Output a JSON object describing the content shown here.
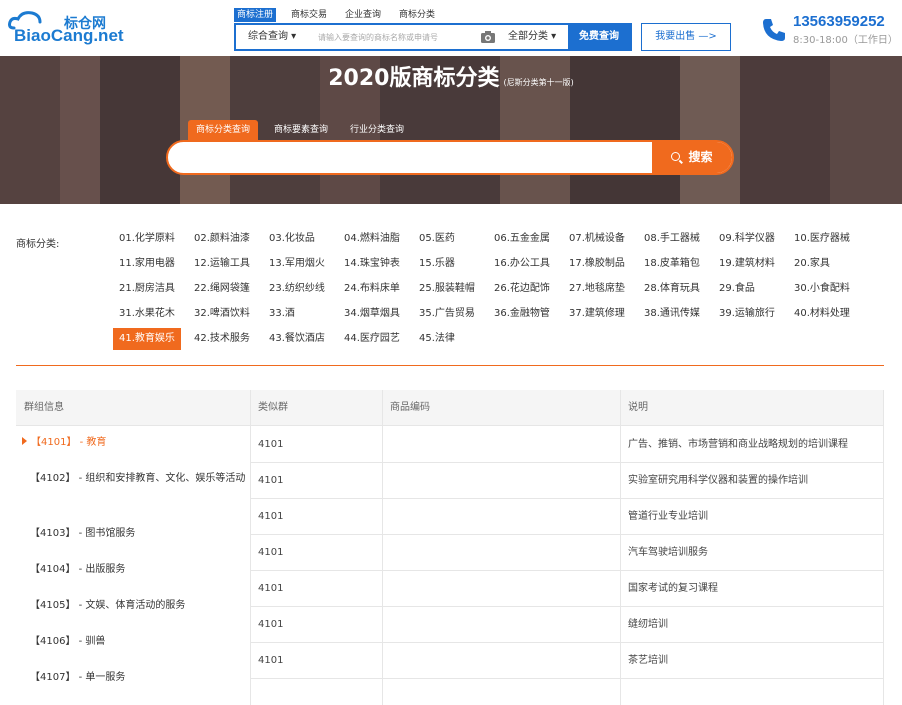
{
  "header": {
    "logo_cn": "标仓网",
    "logo_en": "BiaoCang.net",
    "nav_tabs": [
      "商标注册",
      "商标交易",
      "企业查询",
      "商标分类"
    ],
    "search_type": "综合查询 ▾",
    "search_placeholder": "请输入要查询的商标名称或申请号",
    "search_category": "全部分类 ▾",
    "search_button": "免费查询",
    "sell_button": "我要出售 —>",
    "phone": "13563959252",
    "hours": "8:30-18:00（工作日）"
  },
  "banner": {
    "title": "2020版商标分类",
    "subtitle": "(尼斯分类第十一版)",
    "tabs": [
      "商标分类查询",
      "商标要素查询",
      "行业分类查询"
    ],
    "search_button": "搜索"
  },
  "categories": {
    "label": "商标分类:",
    "items": [
      "01.化学原料",
      "02.颜料油漆",
      "03.化妆品",
      "04.燃料油脂",
      "05.医药",
      "06.五金金属",
      "07.机械设备",
      "08.手工器械",
      "09.科学仪器",
      "10.医疗器械",
      "11.家用电器",
      "12.运输工具",
      "13.军用烟火",
      "14.珠宝钟表",
      "15.乐器",
      "16.办公工具",
      "17.橡胶制品",
      "18.皮革箱包",
      "19.建筑材料",
      "20.家具",
      "21.厨房洁具",
      "22.绳网袋篷",
      "23.纺织纱线",
      "24.布料床单",
      "25.服装鞋帽",
      "26.花边配饰",
      "27.地毯席垫",
      "28.体育玩具",
      "29.食品",
      "30.小食配料",
      "31.水果花木",
      "32.啤酒饮料",
      "33.酒",
      "34.烟草烟具",
      "35.广告贸易",
      "36.金融物管",
      "37.建筑修理",
      "38.通讯传媒",
      "39.运输旅行",
      "40.材料处理",
      "41.教育娱乐",
      "42.技术服务",
      "43.餐饮酒店",
      "44.医疗园艺",
      "45.法律"
    ],
    "active": "41.教育娱乐"
  },
  "table": {
    "headers": [
      "群组信息",
      "类似群",
      "商品编码",
      "说明"
    ],
    "groups": [
      "【4101】 - 教育",
      "【4102】 - 组织和安排教育、文化、娱乐等活动",
      "【4103】 - 图书馆服务",
      "【4104】 - 出版服务",
      "【4105】 - 文娱、体育活动的服务",
      "【4106】 - 驯兽",
      "【4107】 - 单一服务"
    ],
    "rows": [
      {
        "group": "4101",
        "code": "",
        "desc": "广告、推销、市场营销和商业战略规划的培训课程"
      },
      {
        "group": "4101",
        "code": "",
        "desc": "实验室研究用科学仪器和装置的操作培训"
      },
      {
        "group": "4101",
        "code": "",
        "desc": "管道行业专业培训"
      },
      {
        "group": "4101",
        "code": "",
        "desc": "汽车驾驶培训服务"
      },
      {
        "group": "4101",
        "code": "",
        "desc": "国家考试的复习课程"
      },
      {
        "group": "4101",
        "code": "",
        "desc": "缝纫培训"
      },
      {
        "group": "4101",
        "code": "",
        "desc": "茶艺培训"
      },
      {
        "group": "",
        "code": "",
        "desc": ""
      }
    ]
  },
  "colors": {
    "brand_blue": "#1c6fd0",
    "accent_orange": "#f06a1e"
  }
}
